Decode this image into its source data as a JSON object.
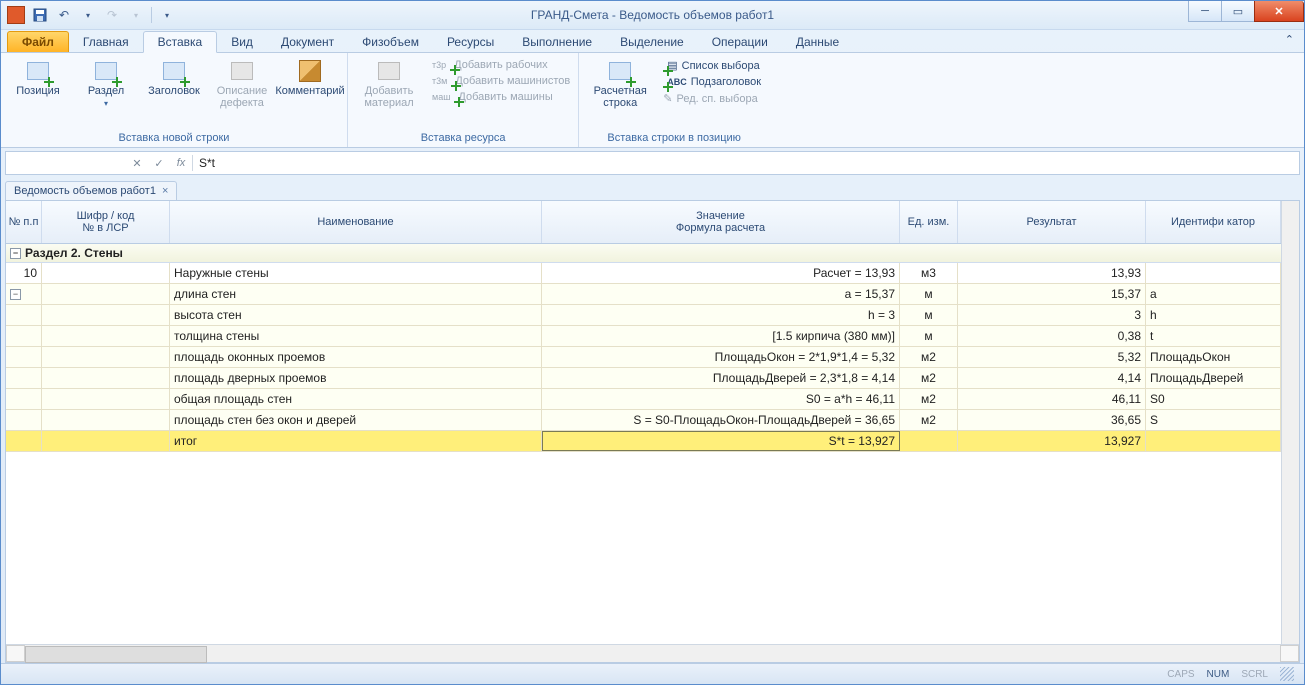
{
  "app": {
    "title": "ГРАНД-Смета - Ведомость объемов работ1"
  },
  "qat": {
    "save": "save-icon",
    "undo": "undo-icon",
    "redo": "redo-icon"
  },
  "tabs": {
    "file": "Файл",
    "items": [
      "Главная",
      "Вставка",
      "Вид",
      "Документ",
      "Физобъем",
      "Ресурсы",
      "Выполнение",
      "Выделение",
      "Операции",
      "Данные"
    ],
    "active_index": 1
  },
  "ribbon": {
    "group1_title": "Вставка новой строки",
    "group2_title": "Вставка ресурса",
    "group3_title": "Вставка строки в позицию",
    "btn_position": "Позиция",
    "btn_section": "Раздел",
    "btn_header": "Заголовок",
    "btn_defect": "Описание дефекта",
    "btn_comment": "Комментарий",
    "btn_add_material": "Добавить материал",
    "btn_add_workers": "Добавить рабочих",
    "btn_add_machinists": "Добавить машинистов",
    "btn_add_machines": "Добавить машины",
    "btn_calc_row": "Расчетная строка",
    "btn_choice_list": "Список выбора",
    "btn_subheader": "Подзаголовок",
    "btn_edit_choice": "Ред. сп. выбора"
  },
  "formula_bar": {
    "value": "S*t"
  },
  "doc_tab": {
    "label": "Ведомость объемов работ1"
  },
  "grid": {
    "headers": {
      "npp": "№ п.п",
      "code": "Шифр / код\n№ в ЛСР",
      "name": "Наименование",
      "value": "Значение\nФормула расчета",
      "unit": "Ед. изм.",
      "result": "Результат",
      "ident": "Идентифи катор"
    },
    "section": "Раздел 2. Стены",
    "rows": [
      {
        "npp": "10",
        "code": "",
        "name": "Наружные стены",
        "value": "Расчет = 13,93",
        "unit": "м3",
        "result": "13,93",
        "ident": "",
        "alt": false
      },
      {
        "npp": "",
        "code": "",
        "name": "длина стен",
        "value": "a = 15,37",
        "unit": "м",
        "result": "15,37",
        "ident": "a",
        "alt": true
      },
      {
        "npp": "",
        "code": "",
        "name": "высота стен",
        "value": "h = 3",
        "unit": "м",
        "result": "3",
        "ident": "h",
        "alt": true
      },
      {
        "npp": "",
        "code": "",
        "name": "толщина стены",
        "value": "[1.5 кирпича (380 мм)]",
        "unit": "м",
        "result": "0,38",
        "ident": "t",
        "alt": true
      },
      {
        "npp": "",
        "code": "",
        "name": "площадь оконных проемов",
        "value": "ПлощадьОкон = 2*1,9*1,4 = 5,32",
        "unit": "м2",
        "result": "5,32",
        "ident": "ПлощадьОкон",
        "alt": true
      },
      {
        "npp": "",
        "code": "",
        "name": "площадь дверных проемов",
        "value": "ПлощадьДверей = 2,3*1,8 = 4,14",
        "unit": "м2",
        "result": "4,14",
        "ident": "ПлощадьДверей",
        "alt": true
      },
      {
        "npp": "",
        "code": "",
        "name": "общая площадь стен",
        "value": "S0 = a*h = 46,11",
        "unit": "м2",
        "result": "46,11",
        "ident": "S0",
        "alt": true
      },
      {
        "npp": "",
        "code": "",
        "name": "площадь стен без окон и дверей",
        "value": "S = S0-ПлощадьОкон-ПлощадьДверей = 36,65",
        "unit": "м2",
        "result": "36,65",
        "ident": "S",
        "alt": true
      },
      {
        "npp": "",
        "code": "",
        "name": "итог",
        "value": "S*t = 13,927",
        "unit": "",
        "result": "13,927",
        "ident": "",
        "alt": true,
        "selected": true
      }
    ]
  },
  "status": {
    "caps": "CAPS",
    "num": "NUM",
    "scrl": "SCRL"
  }
}
